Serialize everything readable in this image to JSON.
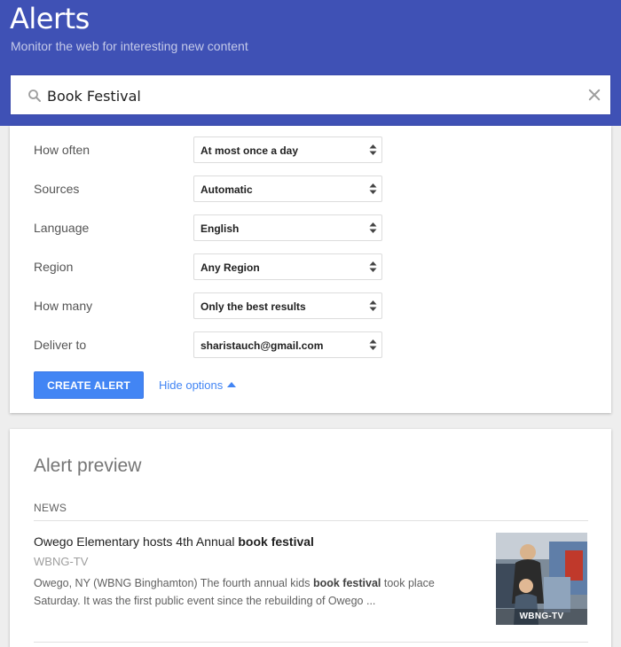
{
  "header": {
    "title": "Alerts",
    "subtitle": "Monitor the web for interesting new content",
    "color": "#3f51b5"
  },
  "search": {
    "value": "Book Festival",
    "icon": "search-icon",
    "clear_icon": "close-icon"
  },
  "options": [
    {
      "label": "How often",
      "value": "At most once a day"
    },
    {
      "label": "Sources",
      "value": "Automatic"
    },
    {
      "label": "Language",
      "value": "English"
    },
    {
      "label": "Region",
      "value": "Any Region"
    },
    {
      "label": "How many",
      "value": "Only the best results"
    },
    {
      "label": "Deliver to",
      "value": "sharistauch@gmail.com"
    }
  ],
  "actions": {
    "create_label": "CREATE ALERT",
    "hide_options_label": "Hide options",
    "accent_color": "#4285f4"
  },
  "preview": {
    "title": "Alert preview",
    "section": "NEWS",
    "item": {
      "title_plain": "Owego Elementary hosts 4th Annual ",
      "title_bold": "book festival",
      "source": "WBNG-TV",
      "snippet_before": "Owego, NY (WBNG Binghamton) The fourth annual kids ",
      "snippet_bold": "book festival",
      "snippet_after": " took place Saturday. It was the first public event since the rebuilding of Owego ...",
      "thumb_caption": "WBNG-TV"
    }
  }
}
